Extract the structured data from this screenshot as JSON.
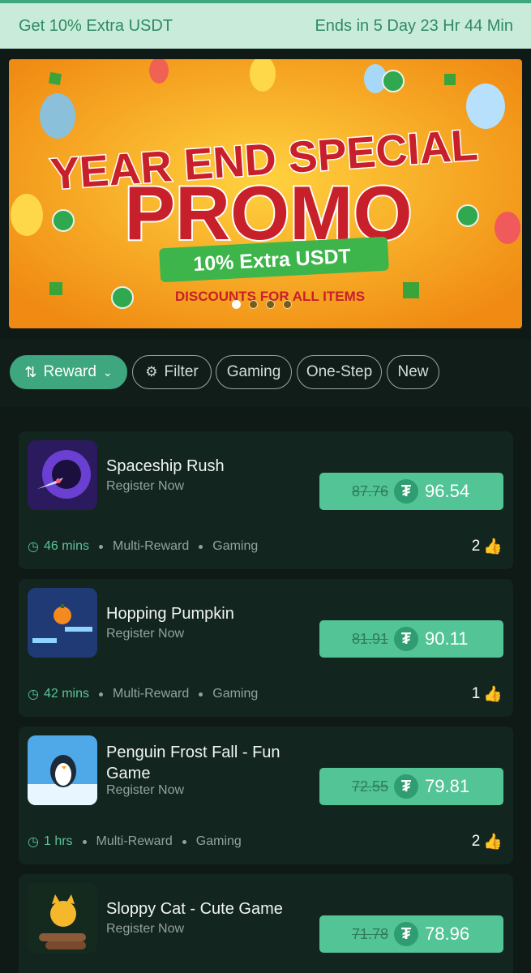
{
  "promo_bar": {
    "label": "Get 10% Extra USDT",
    "countdown": "Ends in 5 Day 23 Hr 44 Min"
  },
  "banner": {
    "line1": "YEAR END SPECIAL",
    "line2": "PROMO",
    "badge": "10% Extra USDT",
    "tagline": "DISCOUNTS FOR ALL ITEMS",
    "slides": 4,
    "active_slide": 1
  },
  "filters": {
    "sort_label": "Reward",
    "filter_label": "Filter",
    "chips": [
      "Gaming",
      "One-Step",
      "New"
    ]
  },
  "cards": [
    {
      "title": "Spaceship Rush",
      "subtitle": "Register Now",
      "old_price": "87.76",
      "new_price": "96.54",
      "duration": "46 mins",
      "tag1": "Multi-Reward",
      "tag2": "Gaming",
      "likes": "2",
      "thumb": "spaceship"
    },
    {
      "title": "Hopping Pumpkin",
      "subtitle": "Register Now",
      "old_price": "81.91",
      "new_price": "90.11",
      "duration": "42 mins",
      "tag1": "Multi-Reward",
      "tag2": "Gaming",
      "likes": "1",
      "thumb": "pumpkin"
    },
    {
      "title": "Penguin Frost Fall - Fun Game",
      "subtitle": "Register Now",
      "old_price": "72.55",
      "new_price": "79.81",
      "duration": "1 hrs",
      "tag1": "Multi-Reward",
      "tag2": "Gaming",
      "likes": "2",
      "thumb": "penguin"
    },
    {
      "title": "Sloppy Cat - Cute Game",
      "subtitle": "Register Now",
      "old_price": "71.78",
      "new_price": "78.96",
      "duration": "",
      "tag1": "",
      "tag2": "",
      "likes": "",
      "thumb": "cat"
    }
  ],
  "colors": {
    "accent": "#3fa77f",
    "price_bg": "#52c496",
    "banner_bg": "#f6a623",
    "promo_red": "#c8202a"
  }
}
